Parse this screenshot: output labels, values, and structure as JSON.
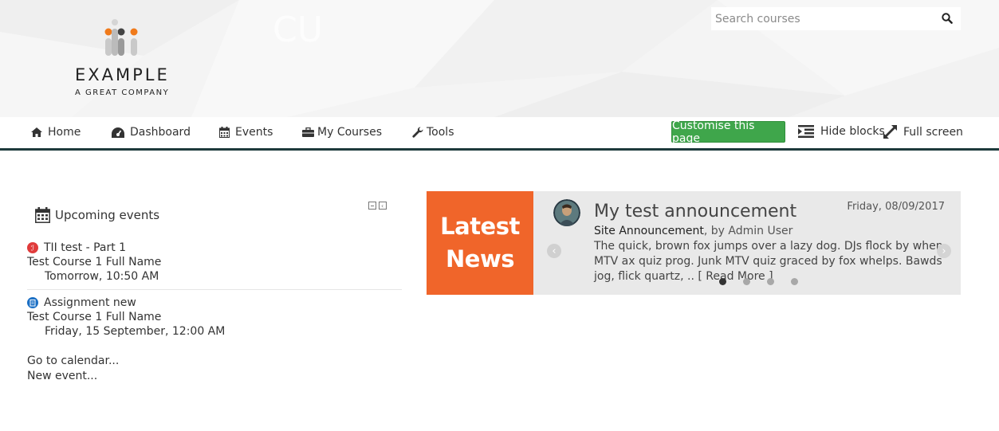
{
  "site": {
    "logo_word": "EXAMPLE",
    "logo_tagline": "A GREAT COMPANY"
  },
  "search": {
    "placeholder": "Search courses",
    "icon": "search-icon"
  },
  "nav": {
    "items": [
      {
        "label": "Home",
        "icon": "home-icon"
      },
      {
        "label": "Dashboard",
        "icon": "dashboard-icon"
      },
      {
        "label": "Events",
        "icon": "calendar-icon"
      },
      {
        "label": "My Courses",
        "icon": "briefcase-icon"
      },
      {
        "label": "Tools",
        "icon": "wrench-icon"
      }
    ],
    "customise_label": "Customise this page",
    "hide_blocks_label": "Hide blocks",
    "full_screen_label": "Full screen"
  },
  "upcoming": {
    "title": "Upcoming events",
    "events": [
      {
        "name": "TII test - Part 1",
        "course": "Test Course 1 Full Name",
        "date": "Tomorrow, 10:50 AM",
        "icon": "turnitin-icon",
        "icon_color": "#e03b3b"
      },
      {
        "name": "Assignment new",
        "course": "Test Course 1 Full Name",
        "date": "Friday, 15 September, 12:00 AM",
        "icon": "assignment-icon",
        "icon_color": "#1b6fc4"
      }
    ],
    "calendar_link": "Go to calendar...",
    "new_event_link": "New event..."
  },
  "news": {
    "label_line1": "Latest",
    "label_line2": "News",
    "title": "My test announcement",
    "date": "Friday, 08/09/2017",
    "forum": "Site Announcement",
    "byline": ", by Admin User",
    "body": "The quick, brown fox jumps over a lazy dog. DJs flock by when MTV ax quiz prog. Junk MTV quiz graced by fox whelps. Bawds jog, flick quartz, .. [ Read More ]",
    "slides": 4,
    "active_slide": 1
  },
  "colors": {
    "accent_green": "#3fa64b",
    "news_orange": "#f0652a",
    "nav_border": "#1d3a3c"
  }
}
